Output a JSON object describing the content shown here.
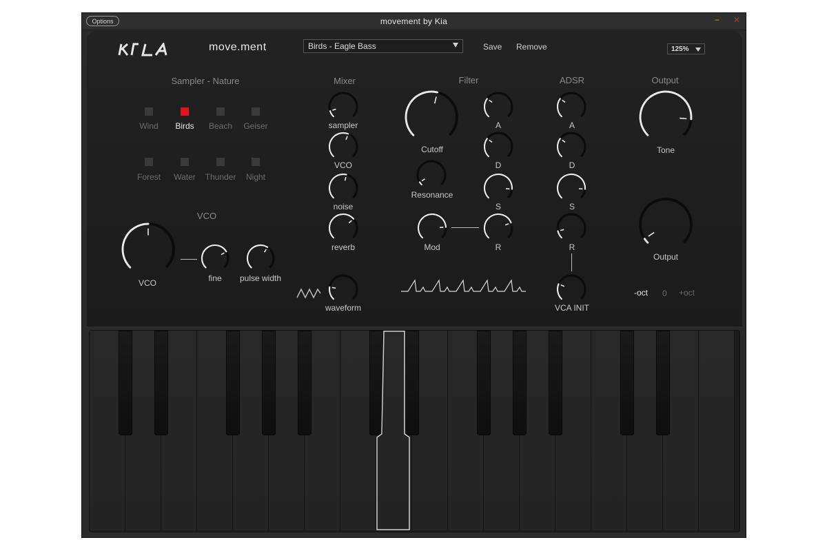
{
  "window": {
    "title": "movement by Kia",
    "options_label": "Options",
    "minimize_glyph": "−",
    "close_glyph": "✕"
  },
  "header": {
    "brand_logo": "KIA",
    "app_name": "move.ment",
    "preset": "Birds - Eagle Bass",
    "save_label": "Save",
    "remove_label": "Remove",
    "zoom": "125%"
  },
  "sampler": {
    "title": "Sampler - Nature",
    "items": [
      {
        "label": "Wind",
        "active": false
      },
      {
        "label": "Birds",
        "active": true
      },
      {
        "label": "Beach",
        "active": false
      },
      {
        "label": "Geiser",
        "active": false
      },
      {
        "label": "Forest",
        "active": false
      },
      {
        "label": "Water",
        "active": false
      },
      {
        "label": "Thunder",
        "active": false
      },
      {
        "label": "Night",
        "active": false
      }
    ]
  },
  "vco": {
    "title": "VCO",
    "vco_label": "VCO",
    "fine_label": "fine",
    "pulse_label": "pulse width"
  },
  "mixer": {
    "title": "Mixer",
    "sampler": "sampler",
    "vco": "VCO",
    "noise": "noise",
    "reverb": "reverb",
    "waveform": "waveform"
  },
  "filter": {
    "title": "Filter",
    "cutoff": "Cutoff",
    "resonance": "Resonance",
    "mod": "Mod",
    "a": "A",
    "d": "D",
    "s": "S",
    "r": "R"
  },
  "adsr": {
    "title": "ADSR",
    "a": "A",
    "d": "D",
    "s": "S",
    "r": "R",
    "vca_init": "VCA INIT"
  },
  "output": {
    "title": "Output",
    "tone": "Tone",
    "output": "Output",
    "oct_down": "-oct",
    "oct_value": "0",
    "oct_up": "+oct"
  },
  "colors": {
    "accent_red": "#e0141e",
    "panel": "#1e1e1e",
    "knob_arc": "#e8e8e8"
  },
  "keyboard": {
    "pressed_key": "highlighted key"
  }
}
